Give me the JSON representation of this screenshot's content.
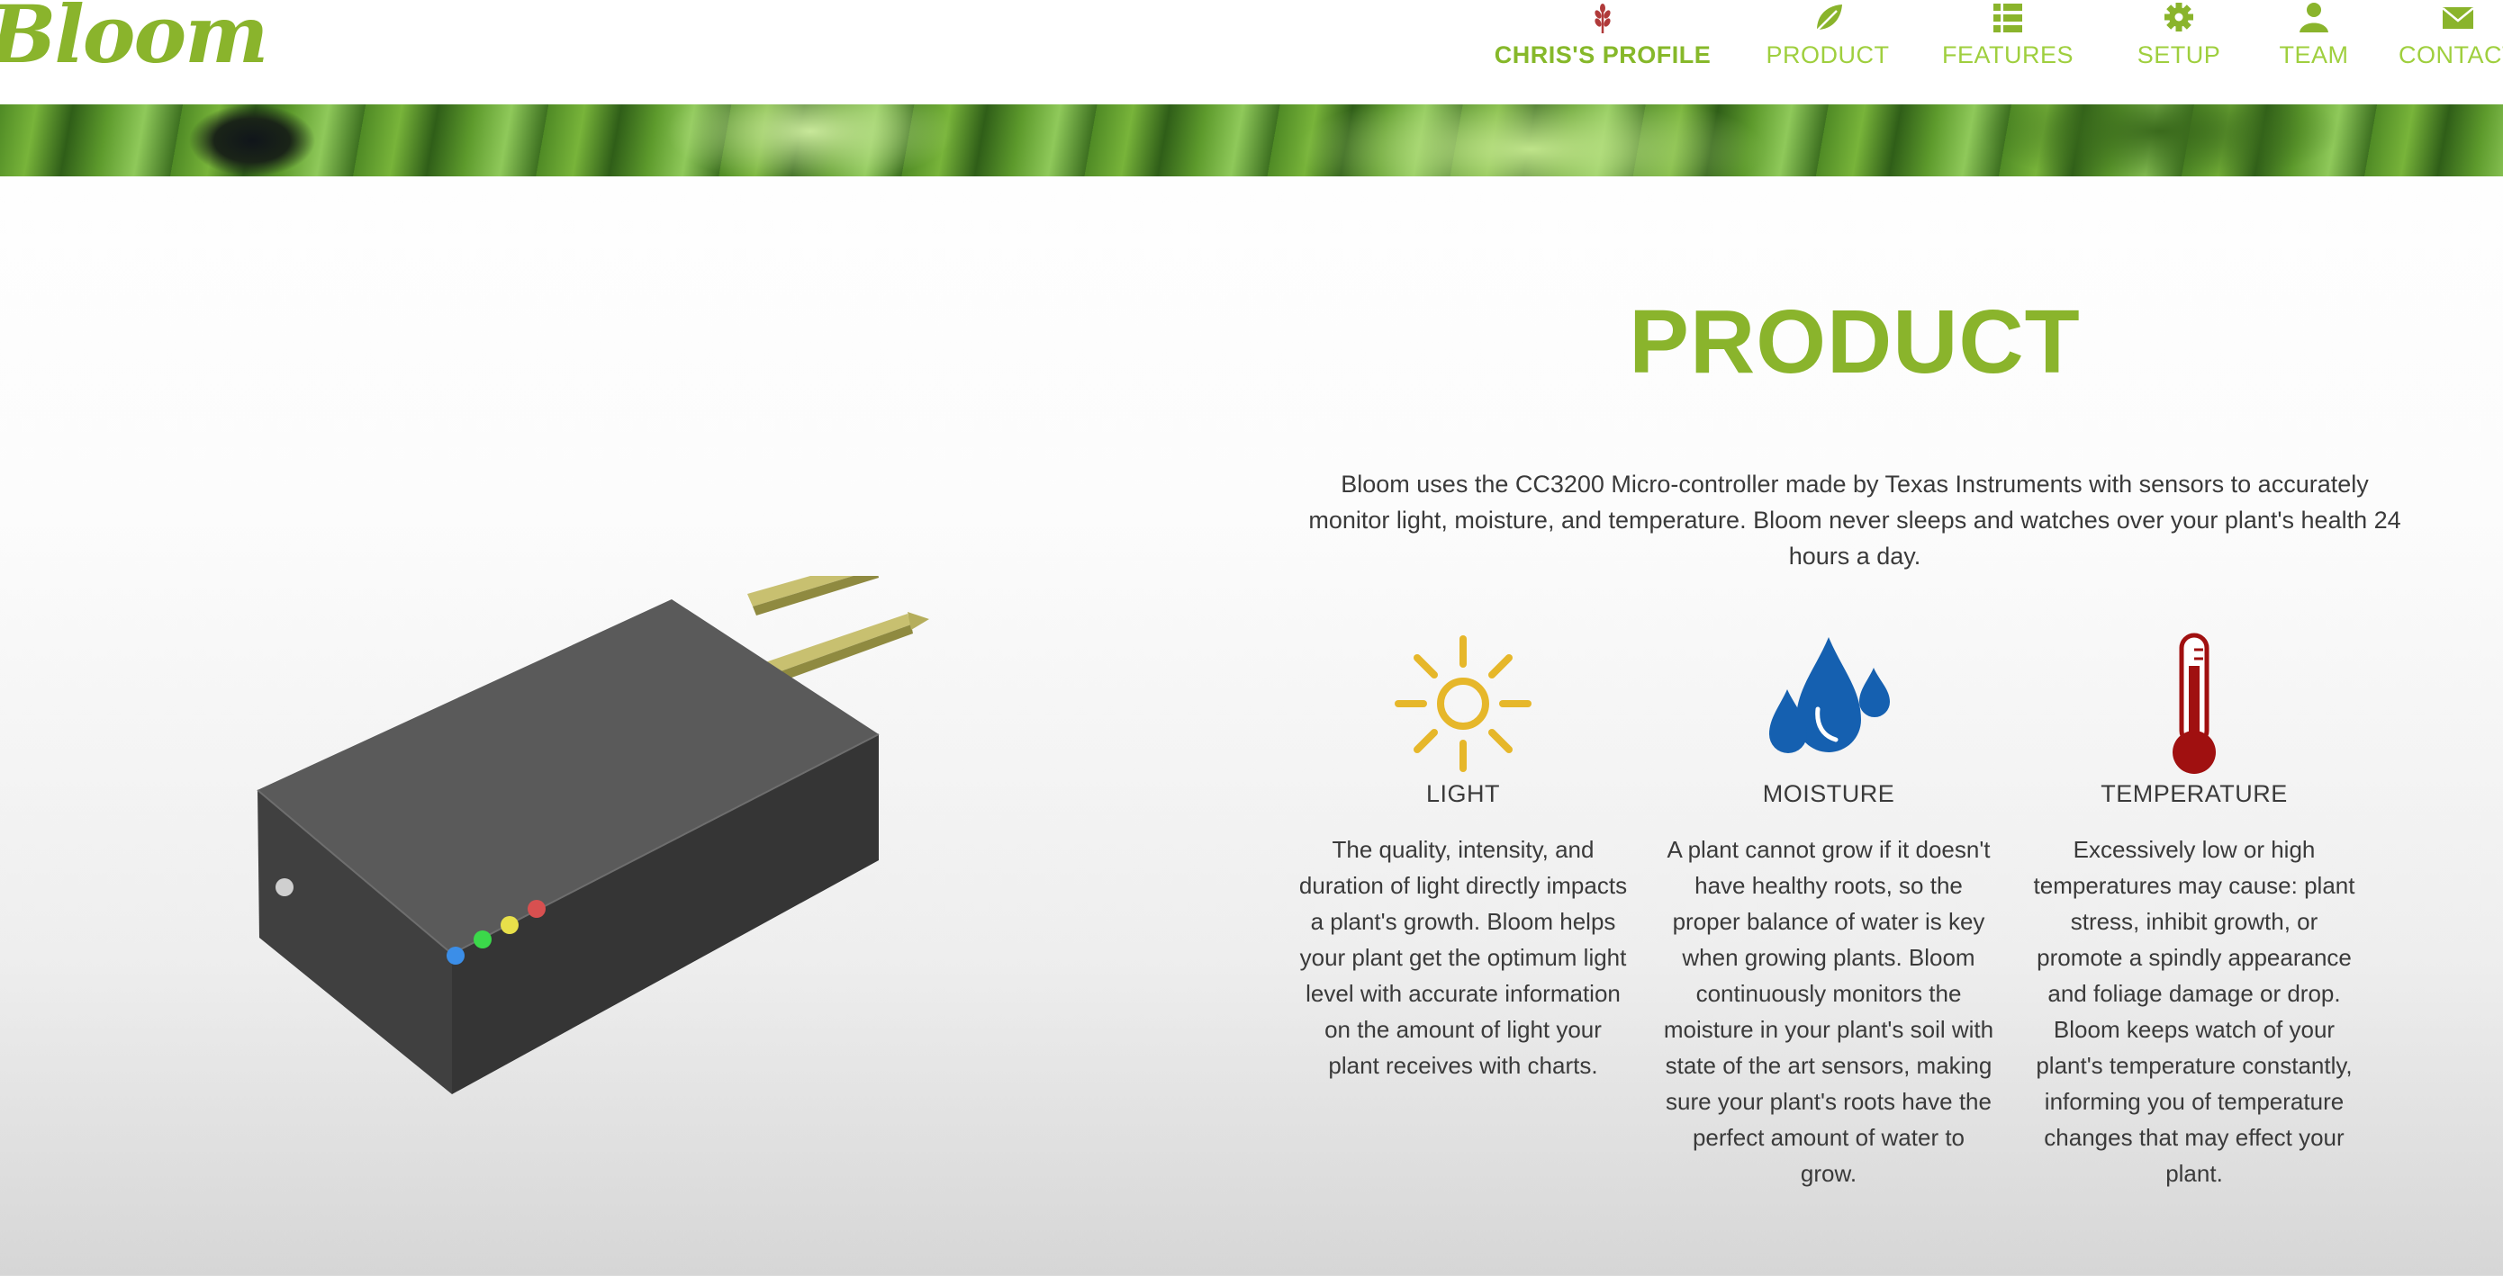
{
  "brand": {
    "logo_text": "Bloom",
    "accent_color": "#8ab42c"
  },
  "nav": {
    "items": [
      {
        "label": "CHRIS'S PROFILE",
        "icon": "wheat-icon",
        "active": true
      },
      {
        "label": "PRODUCT",
        "icon": "leaf-icon",
        "active": false
      },
      {
        "label": "FEATURES",
        "icon": "list-icon",
        "active": false
      },
      {
        "label": "SETUP",
        "icon": "gear-icon",
        "active": false
      },
      {
        "label": "TEAM",
        "icon": "person-icon",
        "active": false
      },
      {
        "label": "CONTACT",
        "icon": "envelope-icon",
        "active": false
      }
    ]
  },
  "banner": {
    "image": "green-foliage-banner"
  },
  "product": {
    "device_image": "bloom-sensor-device",
    "title": "PRODUCT",
    "description": "Bloom uses the CC3200 Micro-controller made by Texas Instruments with sensors to accurately monitor light, moisture, and temperature. Bloom never sleeps and watches over your plant's health 24 hours a day.",
    "features": [
      {
        "title": "LIGHT",
        "icon": "sun-icon",
        "icon_color": "#e6b72a",
        "text": "The quality, intensity, and duration of light directly impacts a plant's growth. Bloom helps your plant get the optimum light level with accurate information on the amount of light your plant receives with charts."
      },
      {
        "title": "MOISTURE",
        "icon": "water-drops-icon",
        "icon_color": "#1560b0",
        "text": "A plant cannot grow if it doesn't have healthy roots, so the proper balance of water is key when growing plants. Bloom continuously monitors the moisture in your plant's soil with state of the art sensors, making sure your plant's roots have the perfect amount of water to grow."
      },
      {
        "title": "TEMPERATURE",
        "icon": "thermometer-icon",
        "icon_color": "#a01010",
        "text": "Excessively low or high temperatures may cause: plant stress, inhibit growth, or promote a spindly appearance and foliage damage or drop. Bloom keeps watch of your plant's temperature constantly, informing you of temperature changes that may effect your plant."
      }
    ]
  }
}
